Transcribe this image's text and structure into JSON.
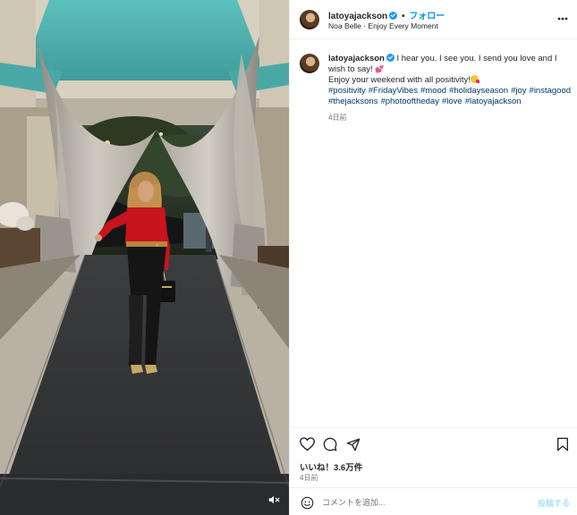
{
  "post": {
    "username": "latoyajackson",
    "follow_label": "フォロー",
    "separator": "•",
    "audio": "Noa Belle · Enjoy Every Moment",
    "caption": {
      "username": "latoyajackson",
      "line1": "I hear you. I see you. I send you love and I wish to say!",
      "line2": "Enjoy your weekend with all positivity!",
      "hashtags": [
        "#positivity",
        "#FridayVibes",
        "#mood",
        "#holidayseason",
        "#joy",
        "#instagood",
        "#thejacksons",
        "#photooftheday",
        "#love",
        "#latoyajackson"
      ],
      "time": "4日前"
    },
    "likes": "いいね！3.6万件",
    "time": "4日前"
  },
  "comment": {
    "placeholder": "コメントを追加...",
    "post_label": "投稿する"
  },
  "icons": {
    "more": "more-horizontal-icon",
    "like": "heart-icon",
    "comment": "comment-icon",
    "share": "share-icon",
    "save": "bookmark-icon",
    "emoji": "emoji-icon",
    "mute": "speaker-muted-icon",
    "verified": "verified-badge-icon"
  },
  "colors": {
    "link_blue": "#0095f6",
    "hashtag_blue": "#00376b",
    "muted_text": "#737373",
    "verified": "#1d9bf0",
    "shirt_red": "#c8141c",
    "canopy_teal": "#4fb3b0"
  }
}
